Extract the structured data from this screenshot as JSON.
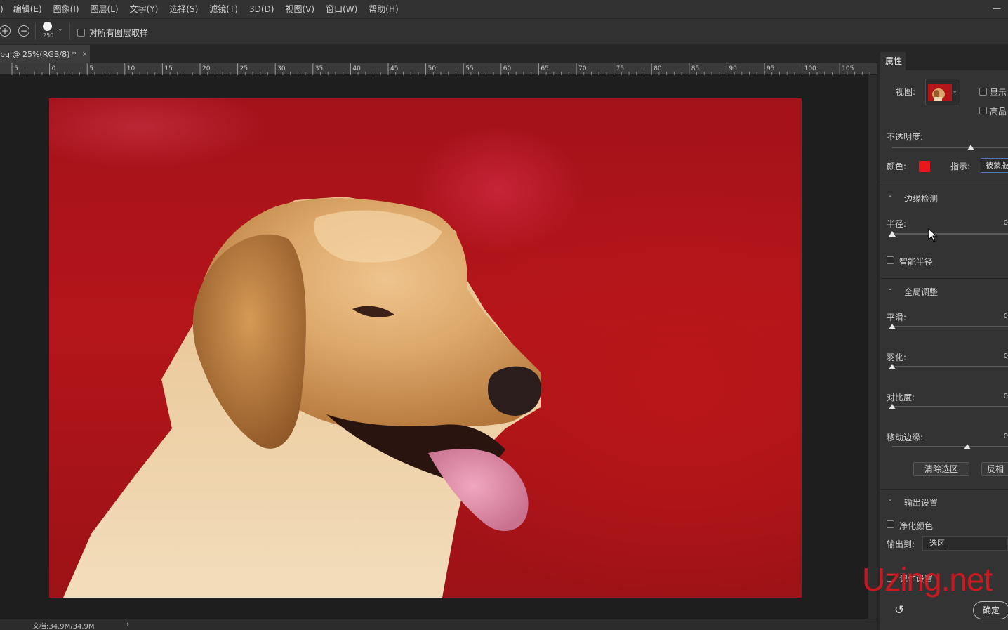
{
  "menubar": {
    "first_fragment": ")",
    "items": [
      "编辑(E)",
      "图像(I)",
      "图层(L)",
      "文字(Y)",
      "选择(S)",
      "滤镜(T)",
      "3D(D)",
      "视图(V)",
      "窗口(W)",
      "帮助(H)"
    ],
    "minimize_glyph": "—"
  },
  "options": {
    "add_glyph": "+",
    "subtract_glyph": "−",
    "brush_size": "250",
    "brush_caret": "⌄",
    "sample_all_layers": "对所有图层取样"
  },
  "document": {
    "tab_title": "pg @ 25%(RGB/8) *",
    "close_glyph": "×",
    "doc_size": "文档:34.9M/34.9M",
    "status_arrow": "›"
  },
  "ruler": {
    "labels": [
      "5",
      "0",
      "5",
      "10",
      "15",
      "20",
      "25",
      "30",
      "35",
      "40",
      "45",
      "50",
      "55",
      "60",
      "65",
      "70",
      "75",
      "80",
      "85",
      "90",
      "95",
      "100",
      "105"
    ]
  },
  "properties": {
    "tab": "属性",
    "view_label": "视图:",
    "view_caret": "⌄",
    "show_edge": "显示",
    "high_quality": "高品",
    "opacity_label": "不透明度:",
    "opacity_level": 0.68,
    "color_label": "颜色:",
    "color": "#e8171b",
    "indicate_label": "指示:",
    "indicate_value": "被蒙版",
    "edge_detection": {
      "title": "边缘检测",
      "radius_label": "半径:",
      "radius_value": "0",
      "radius_level": 0,
      "smart_radius": "智能半径"
    },
    "global_refinements": {
      "title": "全局调整",
      "smooth_label": "平滑:",
      "smooth_value": "0",
      "feather_label": "羽化:",
      "feather_value": "0",
      "contrast_label": "对比度:",
      "contrast_value": "0",
      "shift_edge_label": "移动边缘:",
      "shift_edge_value": "0",
      "shift_edge_level": 0.65,
      "clear_selection": "清除选区",
      "invert": "反相"
    },
    "output": {
      "title": "输出设置",
      "decontaminate": "净化颜色",
      "output_to_label": "输出到:",
      "output_to_value": "选区",
      "remember": "记住设置"
    },
    "reset_glyph": "↺",
    "ok": "确定",
    "chevron_glyph": "⌄"
  },
  "watermark": "Uzing.net"
}
